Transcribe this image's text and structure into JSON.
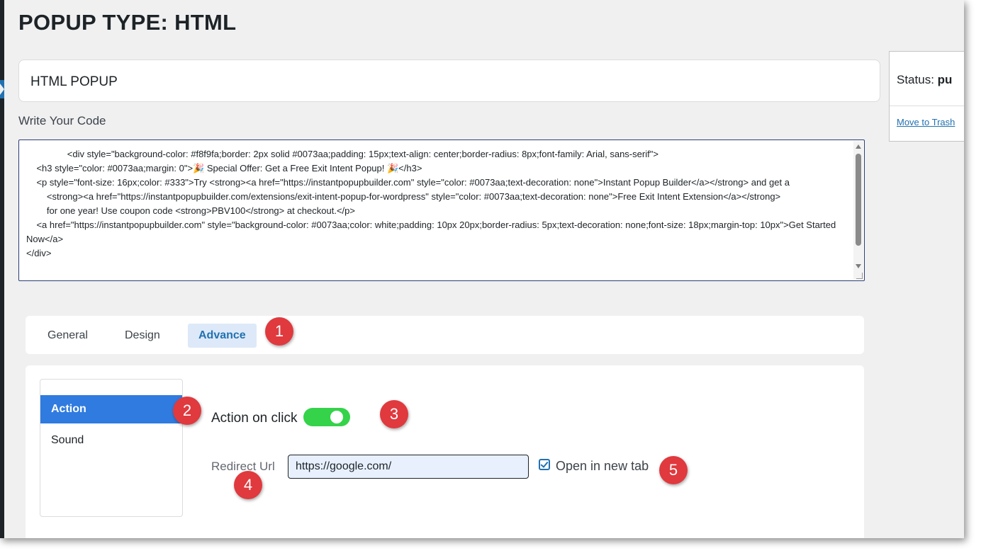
{
  "page": {
    "title": "POPUP TYPE: HTML"
  },
  "popup": {
    "title_value": "HTML POPUP"
  },
  "editor": {
    "label": "Write Your Code",
    "code": "                <div style=\"background-color: #f8f9fa;border: 2px solid #0073aa;padding: 15px;text-align: center;border-radius: 8px;font-family: Arial, sans-serif\">\n    <h3 style=\"color: #0073aa;margin: 0\">🎉 Special Offer: Get a Free Exit Intent Popup! 🎉</h3>\n    <p style=\"font-size: 16px;color: #333\">Try <strong><a href=\"https://instantpopupbuilder.com\" style=\"color: #0073aa;text-decoration: none\">Instant Popup Builder</a></strong> and get a\n        <strong><a href=\"https://instantpopupbuilder.com/extensions/exit-intent-popup-for-wordpress\" style=\"color: #0073aa;text-decoration: none\">Free Exit Intent Extension</a></strong>\n        for one year! Use coupon code <strong>PBV100</strong> at checkout.</p>\n    <a href=\"https://instantpopupbuilder.com\" style=\"background-color: #0073aa;color: white;padding: 10px 20px;border-radius: 5px;text-decoration: none;font-size: 18px;margin-top: 10px\">Get Started Now</a>\n</div>"
  },
  "status_box": {
    "label": "Status:",
    "value": "pu",
    "trash_link": "Move to Trash"
  },
  "tabs": [
    {
      "label": "General",
      "active": false
    },
    {
      "label": "Design",
      "active": false
    },
    {
      "label": "Advance",
      "active": true
    }
  ],
  "advance": {
    "side_menu": [
      {
        "label": "Action",
        "active": true
      },
      {
        "label": "Sound",
        "active": false
      }
    ],
    "action_on_click": {
      "label": "Action on click",
      "enabled": true
    },
    "redirect": {
      "label": "Redirect Url",
      "value": "https://google.com/",
      "open_in_new_tab_label": "Open in new tab",
      "open_in_new_tab": true
    }
  },
  "callouts": [
    "1",
    "2",
    "3",
    "4",
    "5"
  ],
  "colors": {
    "accent": "#2271b1",
    "active_menu": "#2f7be0",
    "toggle_on": "#34d349",
    "callout": "#e0393e",
    "page_bg": "#f0f0f1"
  }
}
